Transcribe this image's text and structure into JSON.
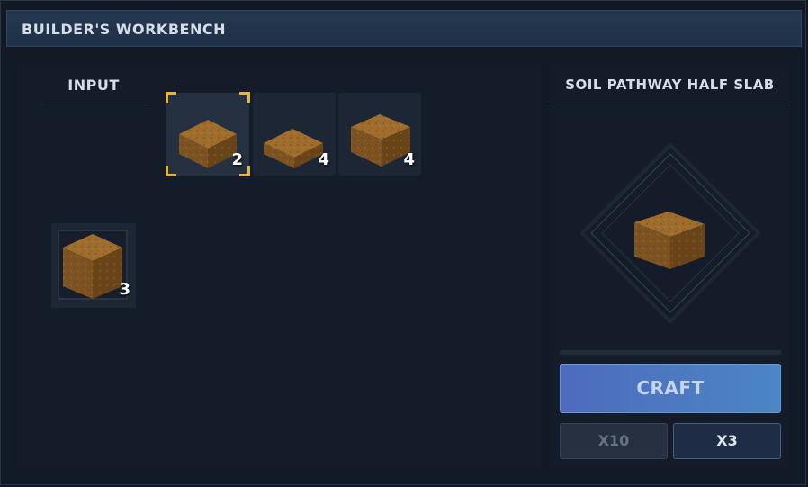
{
  "window": {
    "title": "BUILDER'S WORKBENCH"
  },
  "input_panel": {
    "header": "INPUT",
    "input_slot": {
      "item_icon": "soil-block-icon",
      "count": "3"
    }
  },
  "recipes": [
    {
      "item_icon": "soil-block-icon",
      "count": "2",
      "selected": true
    },
    {
      "item_icon": "soil-slab-icon",
      "count": "4",
      "selected": false
    },
    {
      "item_icon": "soil-block-icon",
      "count": "4",
      "selected": false
    }
  ],
  "output_panel": {
    "item_name": "SOIL PATHWAY HALF SLAB",
    "preview_icon": "soil-half-slab-icon",
    "craft_progress": 0,
    "craft_label": "CRAFT",
    "quantity_options": [
      {
        "label": "X10",
        "enabled": false
      },
      {
        "label": "X3",
        "enabled": true
      }
    ]
  },
  "colors": {
    "selection_accent": "#e9b33b",
    "craft_button": "#4b78c1",
    "soil_top": "#9b6a2a",
    "soil_side": "#7a5020"
  }
}
